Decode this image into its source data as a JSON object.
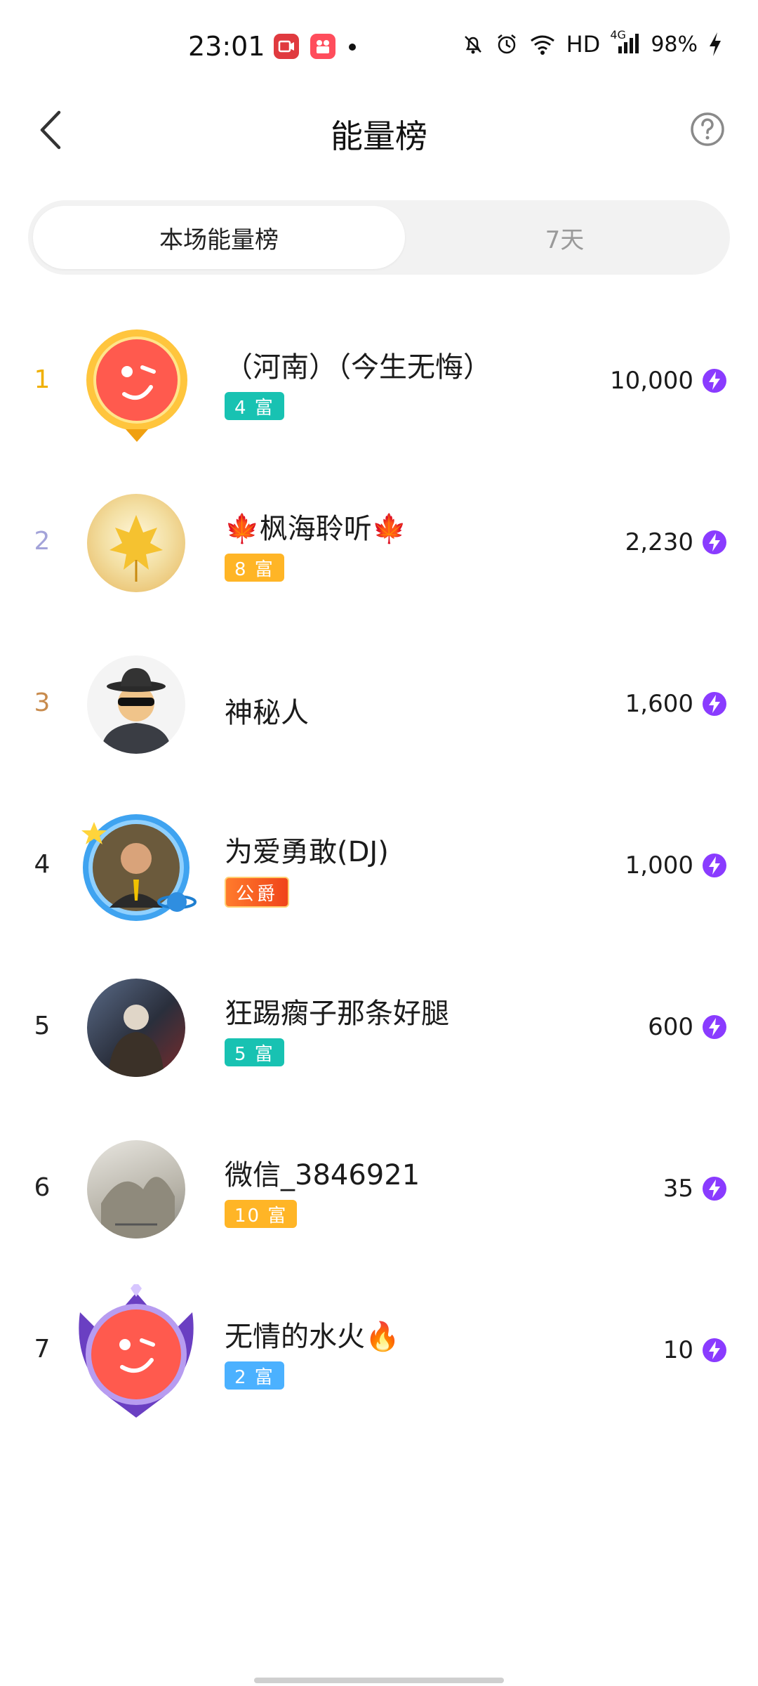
{
  "status_bar": {
    "time": "23:01",
    "network": "HD",
    "signal_type": "4G",
    "battery": "98%",
    "icons": [
      "screen-record-icon",
      "app-notification-icon",
      "mute-bell-icon",
      "alarm-icon",
      "wifi-icon",
      "signal-icon",
      "charging-icon"
    ]
  },
  "header": {
    "title": "能量榜",
    "back_icon": "chevron-left-icon",
    "help_icon": "question-circle-icon"
  },
  "tabs": [
    {
      "label": "本场能量榜",
      "active": true
    },
    {
      "label": "7天",
      "active": false
    }
  ],
  "colors": {
    "rank1": "#f0b000",
    "rank2": "#a3a3d9",
    "rank3": "#c88b4d",
    "rank_default": "#222222",
    "badge_teal": "#18c2b2",
    "badge_orange": "#ffb526",
    "badge_blue": "#4bb1ff",
    "badge_duke": "#ff5a1f",
    "bolt": "#8a3bff"
  },
  "leaderboard": [
    {
      "rank": "1",
      "name": "（河南）（今生无悔）",
      "badge": "4 富",
      "badge_color": "teal",
      "score": "10,000"
    },
    {
      "rank": "2",
      "name": "🍁枫海聆听🍁",
      "badge": "8 富",
      "badge_color": "orange",
      "score": "2,230"
    },
    {
      "rank": "3",
      "name": "神秘人",
      "badge": "",
      "badge_color": "",
      "score": "1,600"
    },
    {
      "rank": "4",
      "name": "为爱勇敢(DJ)",
      "badge": "公爵",
      "badge_color": "duke",
      "score": "1,000"
    },
    {
      "rank": "5",
      "name": "狂踢瘸子那条好腿",
      "badge": "5 富",
      "badge_color": "teal",
      "score": "600"
    },
    {
      "rank": "6",
      "name": "微信_3846921",
      "badge": "10 富",
      "badge_color": "orange",
      "score": "35"
    },
    {
      "rank": "7",
      "name": "无情的水火🔥",
      "badge": "2 富",
      "badge_color": "blue",
      "score": "10"
    }
  ]
}
